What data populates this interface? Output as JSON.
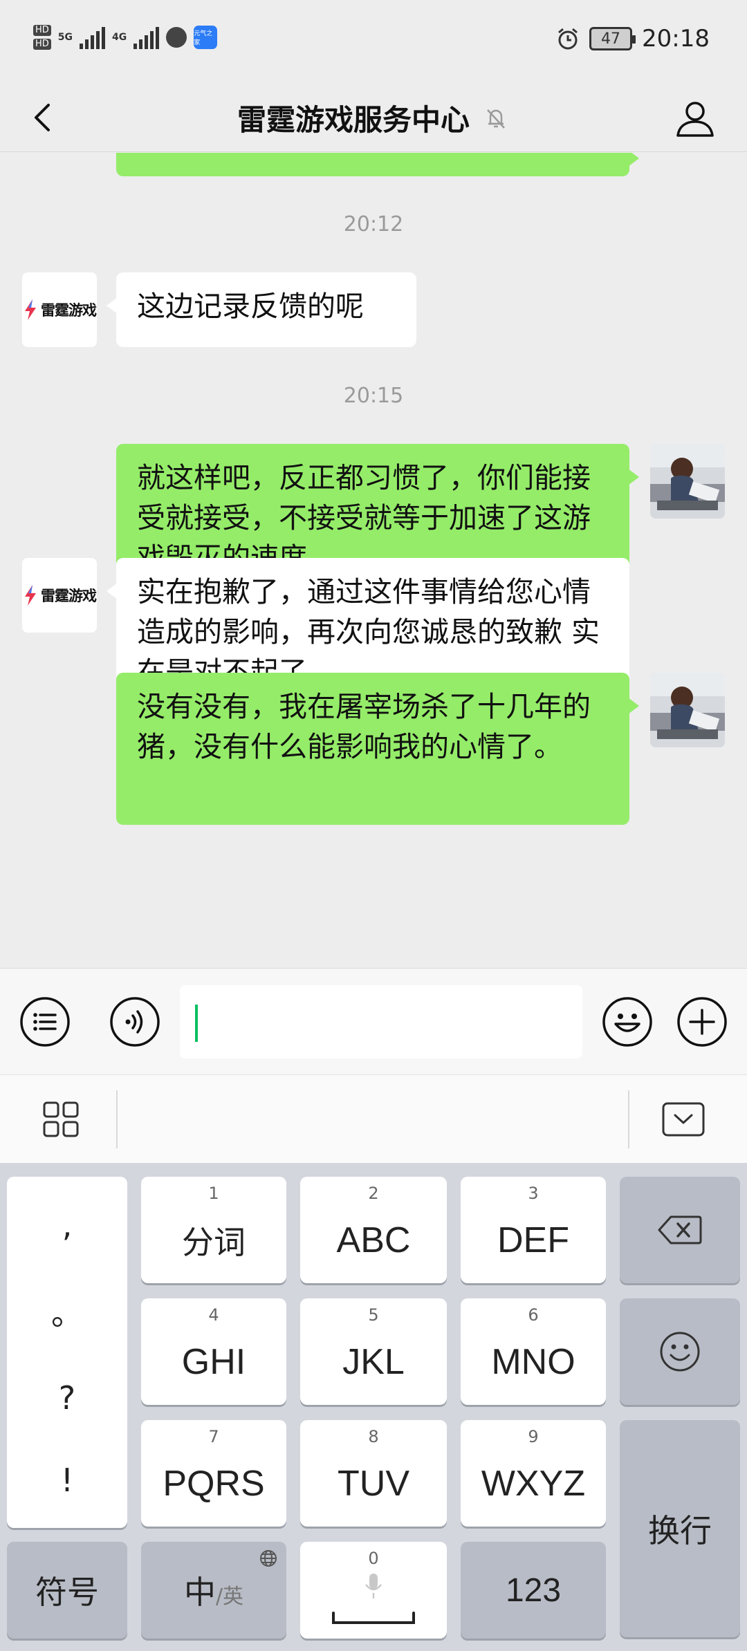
{
  "status_bar": {
    "hd_labels": [
      "HD",
      "HD"
    ],
    "net1": "5G",
    "net2": "4G",
    "app_badge": "元气之家",
    "battery": "47",
    "time": "20:18"
  },
  "header": {
    "title": "雷霆游戏服务中心"
  },
  "messages": {
    "ts1": "20:12",
    "bot1": "这边记录反馈的呢",
    "ts2": "20:15",
    "me1": "就这样吧，反正都习惯了，你们能接受就接受，不接受就等于加速了这游戏毁灭的速度。",
    "bot2": "实在抱歉了，通过这件事情给您心情造成的影响，再次向您诚恳的致歉 实在是对不起了",
    "me2": "没有没有，我在屠宰场杀了十几年的猪，没有什么能影响我的心情了。"
  },
  "bot_logo_text": "雷霆游戏",
  "input": {
    "value": ""
  },
  "keyboard": {
    "punct": [
      ",",
      "。",
      "?",
      "!"
    ],
    "keys": [
      {
        "num": "1",
        "label": "分词"
      },
      {
        "num": "2",
        "label": "ABC"
      },
      {
        "num": "3",
        "label": "DEF"
      },
      {
        "num": "4",
        "label": "GHI"
      },
      {
        "num": "5",
        "label": "JKL"
      },
      {
        "num": "6",
        "label": "MNO"
      },
      {
        "num": "7",
        "label": "PQRS"
      },
      {
        "num": "8",
        "label": "TUV"
      },
      {
        "num": "9",
        "label": "WXYZ"
      }
    ],
    "symbol_key": "符号",
    "lang_main": "中",
    "lang_sub": "/英",
    "space_num": "0",
    "num_key": "123",
    "enter_key": "换行"
  },
  "colors": {
    "my_bubble": "#95ec69",
    "other_bubble": "#ffffff",
    "background": "#ededed",
    "caret": "#07c160"
  }
}
